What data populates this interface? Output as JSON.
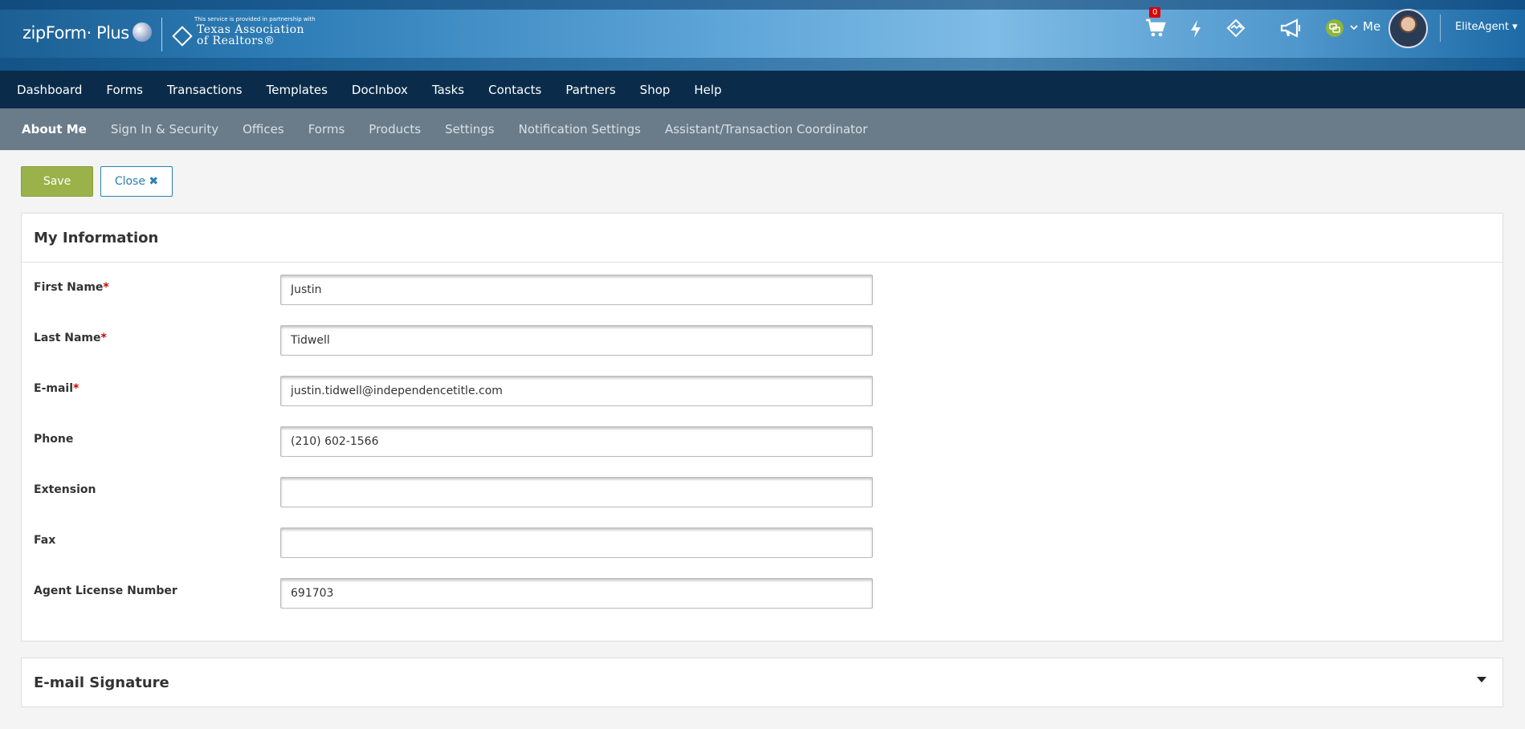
{
  "header": {
    "brand": "zipForm· Plus",
    "partner_tagline": "This service is provided in partnership with",
    "partner_name_line1": "Texas Association",
    "partner_name_line2": "of Realtors®",
    "cart_count": "0",
    "user_label": "Me",
    "account_label": "EliteAgent",
    "icons": [
      "cart-icon",
      "bolt-icon",
      "handshake-icon",
      "megaphone-icon",
      "chat-icon",
      "chevron-down-icon"
    ]
  },
  "main_nav": [
    "Dashboard",
    "Forms",
    "Transactions",
    "Templates",
    "DocInbox",
    "Tasks",
    "Contacts",
    "Partners",
    "Shop",
    "Help"
  ],
  "sub_nav": [
    "About Me",
    "Sign In & Security",
    "Offices",
    "Forms",
    "Products",
    "Settings",
    "Notification Settings",
    "Assistant/Transaction Coordinator"
  ],
  "sub_nav_active": "About Me",
  "actions": {
    "save": "Save",
    "close": "Close"
  },
  "my_information": {
    "title": "My Information",
    "fields": [
      {
        "label": "First Name",
        "required": true,
        "value": "Justin"
      },
      {
        "label": "Last Name",
        "required": true,
        "value": "Tidwell"
      },
      {
        "label": "E-mail",
        "required": true,
        "value": "justin.tidwell@independencetitle.com"
      },
      {
        "label": "Phone",
        "required": false,
        "value": "(210) 602-1566"
      },
      {
        "label": "Extension",
        "required": false,
        "value": ""
      },
      {
        "label": "Fax",
        "required": false,
        "value": ""
      },
      {
        "label": "Agent License Number",
        "required": false,
        "value": "691703"
      }
    ]
  },
  "email_signature": {
    "title": "E-mail Signature"
  },
  "colors": {
    "nav": "#0a2c4a",
    "subnav": "#6a7c8a",
    "save": "#9bb24a",
    "close": "#2a7fb0",
    "required": "#cc0000"
  }
}
